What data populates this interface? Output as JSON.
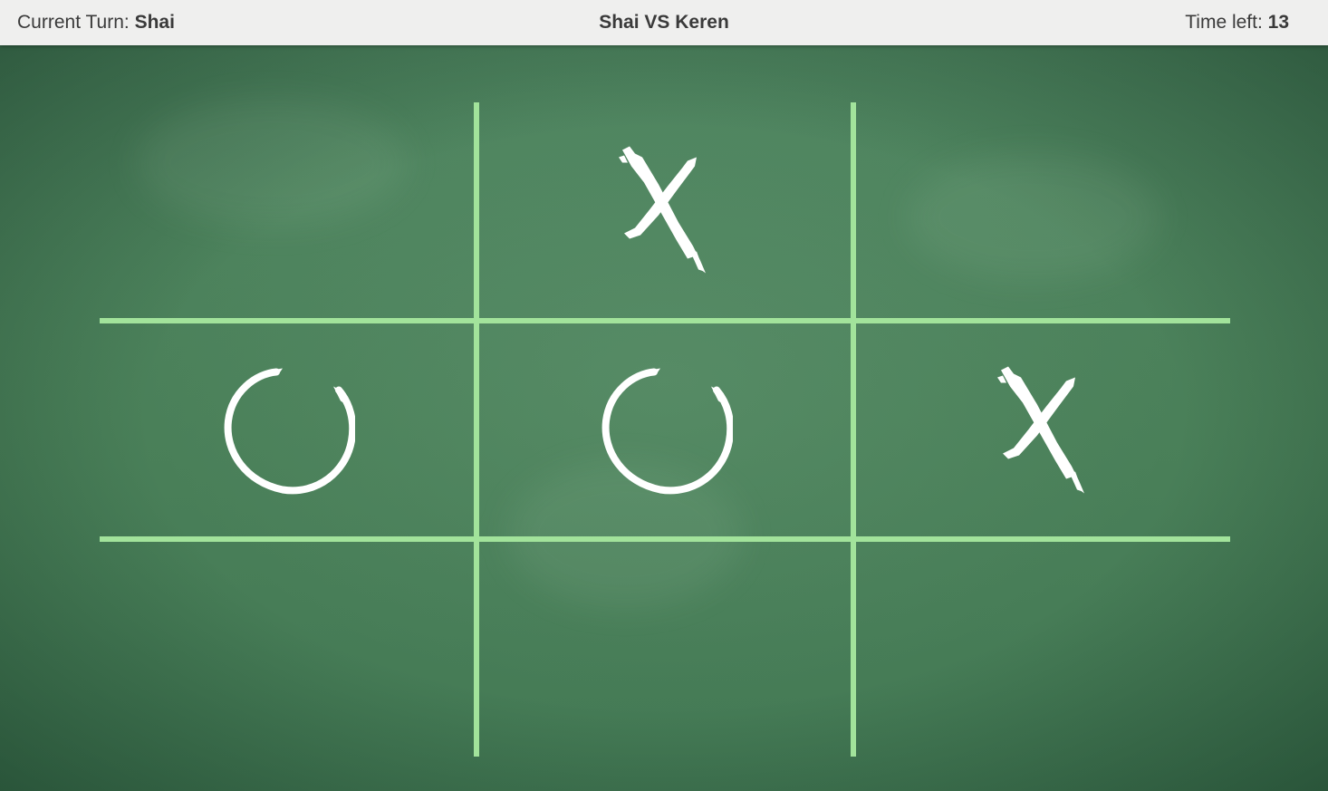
{
  "header": {
    "current_turn_label": "Current Turn: ",
    "current_turn_player": "Shai",
    "match_title": "Shai VS Keren",
    "time_left_label": "Time left: ",
    "time_left_value": "13"
  },
  "board": {
    "cells": [
      "",
      "X",
      "",
      "O",
      "O",
      "X",
      "",
      "",
      ""
    ]
  },
  "colors": {
    "chalkboard": "#4a8059",
    "grid_line": "#a2e39b",
    "chalk": "#ffffff",
    "header_bg": "#efefee"
  },
  "icons": {
    "x_mark": "chalk-x-icon",
    "o_mark": "chalk-o-icon"
  }
}
